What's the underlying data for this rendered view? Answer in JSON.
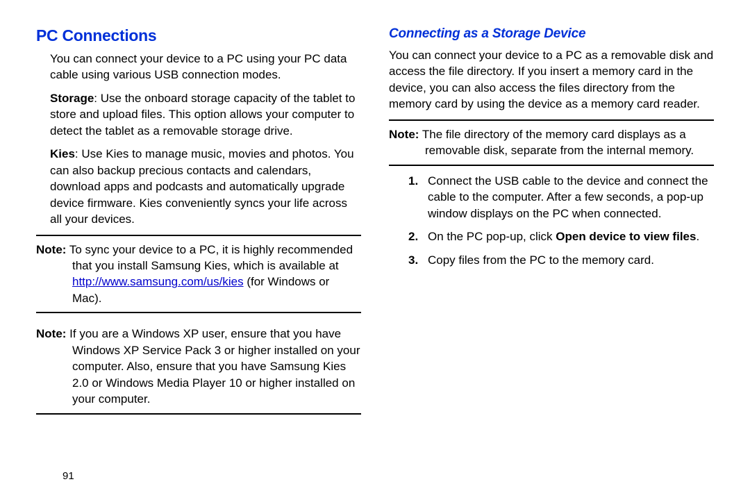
{
  "left": {
    "heading": "PC Connections",
    "intro": "You can connect your device to a PC using your PC data cable using various USB connection modes.",
    "storage_label": "Storage",
    "storage_text": ": Use the onboard storage capacity of the tablet to store and upload files. This option allows your computer to detect the tablet as a removable storage drive.",
    "kies_label": "Kies",
    "kies_text": ": Use Kies to manage music, movies and photos. You can also backup precious contacts and calendars, download apps and podcasts and automatically upgrade device firmware. Kies conveniently syncs your life across all your devices.",
    "note1_label": "Note:",
    "note1_text_a": " To sync your device to a PC, it is highly recommended that you install Samsung Kies, which is available at ",
    "note1_link": "http://www.samsung.com/us/kies",
    "note1_text_b": " (for Windows or Mac).",
    "note2_label": "Note:",
    "note2_text": " If you are a Windows XP user, ensure that you have Windows XP Service Pack 3 or higher installed on your computer. Also, ensure that you have Samsung Kies 2.0 or Windows Media Player 10 or higher installed on your computer."
  },
  "right": {
    "heading": "Connecting as a Storage Device",
    "intro": "You can connect your device to a PC as a removable disk and access the file directory. If you insert a memory card in the device, you can also access the files directory from the memory card by using the device as a memory card reader.",
    "note_label": "Note:",
    "note_text": " The file directory of the memory card displays as a removable disk, separate from the internal memory.",
    "step1": "Connect the USB cable to the device and connect the cable to the computer. After a few seconds, a pop-up window displays on the PC when connected.",
    "step2_a": "On the PC pop-up, click ",
    "step2_bold": "Open device to view files",
    "step2_b": ".",
    "step3": "Copy files from the PC to the memory card."
  },
  "page_number": "91"
}
